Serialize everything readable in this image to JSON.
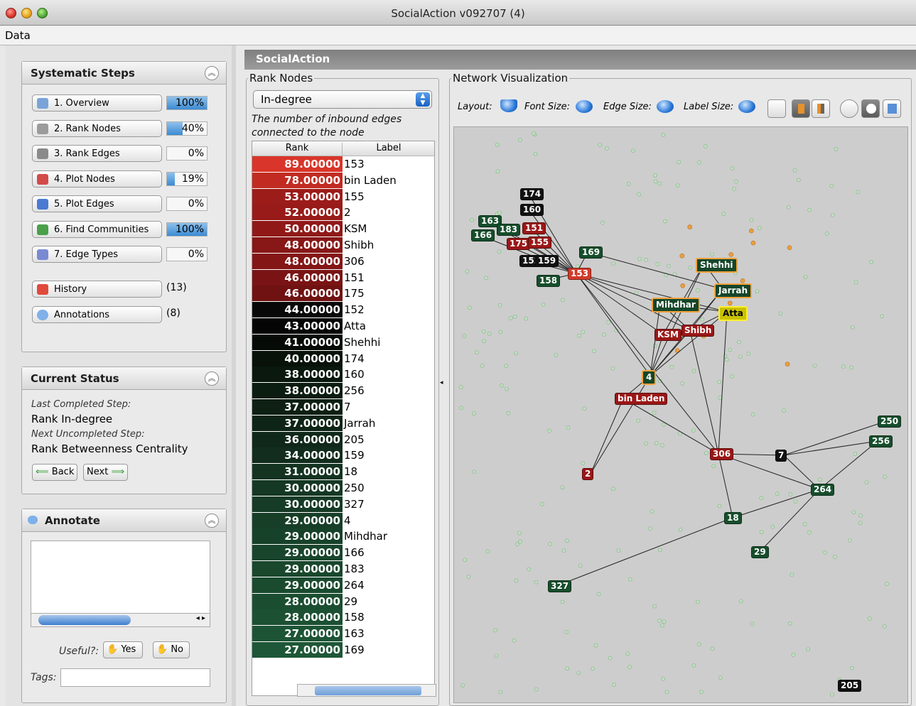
{
  "window": {
    "title": "SocialAction v092707 (4)"
  },
  "menu": {
    "data": "Data"
  },
  "systematic_steps": {
    "title": "Systematic Steps",
    "steps": [
      {
        "label": "1. Overview",
        "percent": "100%",
        "progress": 1.0
      },
      {
        "label": "2. Rank Nodes",
        "percent": "40%",
        "progress": 0.4
      },
      {
        "label": "3. Rank Edges",
        "percent": "0%",
        "progress": 0.0
      },
      {
        "label": "4. Plot Nodes",
        "percent": "19%",
        "progress": 0.19
      },
      {
        "label": "5. Plot Edges",
        "percent": "0%",
        "progress": 0.0
      },
      {
        "label": "6. Find Communities",
        "percent": "100%",
        "progress": 1.0
      },
      {
        "label": "7. Edge Types",
        "percent": "0%",
        "progress": 0.0
      }
    ],
    "history": {
      "label": "History",
      "count": "(13)"
    },
    "annotations": {
      "label": "Annotations",
      "count": "(8)"
    }
  },
  "current_status": {
    "title": "Current Status",
    "last_label": "Last Completed Step:",
    "last_value": "Rank In-degree",
    "next_label": "Next Uncompleted Step:",
    "next_value": "Rank Betweenness Centrality",
    "back": "Back",
    "next": "Next"
  },
  "annotate": {
    "title": "Annotate",
    "useful": "Useful?:",
    "yes": "Yes",
    "no": "No",
    "tags": "Tags:"
  },
  "main": {
    "title": "SocialAction"
  },
  "rank_nodes": {
    "title": "Rank Nodes",
    "selected": "In-degree",
    "description": "The number of inbound edges connected to the node",
    "col_rank": "Rank",
    "col_label": "Label",
    "rows": [
      {
        "rank": "89.00000",
        "label": "153",
        "color": "#d9352a"
      },
      {
        "rank": "78.00000",
        "label": "bin Laden",
        "color": "#c22b22"
      },
      {
        "rank": "53.00000",
        "label": "155",
        "color": "#9c1c1a"
      },
      {
        "rank": "52.00000",
        "label": "2",
        "color": "#981b19"
      },
      {
        "rank": "50.00000",
        "label": "KSM",
        "color": "#901918"
      },
      {
        "rank": "48.00000",
        "label": "Shibh",
        "color": "#881717"
      },
      {
        "rank": "48.00000",
        "label": "306",
        "color": "#841616"
      },
      {
        "rank": "46.00000",
        "label": "151",
        "color": "#7a1414"
      },
      {
        "rank": "46.00000",
        "label": "175",
        "color": "#701212"
      },
      {
        "rank": "44.00000",
        "label": "152",
        "color": "#080808"
      },
      {
        "rank": "43.00000",
        "label": "Atta",
        "color": "#050505"
      },
      {
        "rank": "41.00000",
        "label": "Shehhi",
        "color": "#060a07"
      },
      {
        "rank": "40.00000",
        "label": "174",
        "color": "#081209"
      },
      {
        "rank": "38.00000",
        "label": "160",
        "color": "#0a180d"
      },
      {
        "rank": "38.00000",
        "label": "256",
        "color": "#0b1c10"
      },
      {
        "rank": "37.00000",
        "label": "7",
        "color": "#0d2013"
      },
      {
        "rank": "37.00000",
        "label": "Jarrah",
        "color": "#0e2416"
      },
      {
        "rank": "36.00000",
        "label": "205",
        "color": "#10281a"
      },
      {
        "rank": "34.00000",
        "label": "159",
        "color": "#122d1d"
      },
      {
        "rank": "31.00000",
        "label": "18",
        "color": "#143321"
      },
      {
        "rank": "30.00000",
        "label": "250",
        "color": "#153824"
      },
      {
        "rank": "30.00000",
        "label": "327",
        "color": "#163b26"
      },
      {
        "rank": "29.00000",
        "label": "4",
        "color": "#173f28"
      },
      {
        "rank": "29.00000",
        "label": "Mihdhar",
        "color": "#17422a"
      },
      {
        "rank": "29.00000",
        "label": "166",
        "color": "#18452c"
      },
      {
        "rank": "29.00000",
        "label": "183",
        "color": "#19482d"
      },
      {
        "rank": "29.00000",
        "label": "264",
        "color": "#1a4b2f"
      },
      {
        "rank": "28.00000",
        "label": "29",
        "color": "#1b4e31"
      },
      {
        "rank": "28.00000",
        "label": "158",
        "color": "#1c5133"
      },
      {
        "rank": "27.00000",
        "label": "163",
        "color": "#1d5435"
      },
      {
        "rank": "27.00000",
        "label": "169",
        "color": "#1e5737"
      }
    ]
  },
  "network": {
    "title": "Network Visualization",
    "layout": "Layout:",
    "font_size": "Font Size:",
    "edge_size": "Edge Size:",
    "label_size": "Label Size:",
    "nodes": [
      "174",
      "160",
      "163",
      "183",
      "151",
      "166",
      "175",
      "155",
      "152",
      "159",
      "169",
      "153",
      "158",
      "Shehhi",
      "Jarrah",
      "Mihdhar",
      "Atta",
      "KSM",
      "Shibh",
      "4",
      "bin Laden",
      "250",
      "256",
      "306",
      "7",
      "2",
      "264",
      "18",
      "29",
      "327",
      "205"
    ]
  }
}
